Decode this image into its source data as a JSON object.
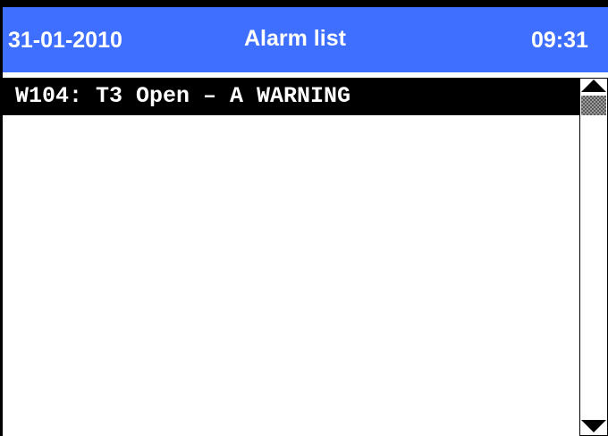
{
  "header": {
    "date": "31-01-2010",
    "title": "Alarm list",
    "time": "09:31"
  },
  "alarms": [
    {
      "text": "W104: T3 Open – A WARNING",
      "selected": true
    }
  ],
  "scrollbar": {
    "position": 0
  },
  "colors": {
    "header_background": "#3f6fff",
    "header_text": "#ffffff",
    "selected_row_background": "#000000",
    "selected_row_text": "#ffffff",
    "list_background": "#ffffff"
  }
}
